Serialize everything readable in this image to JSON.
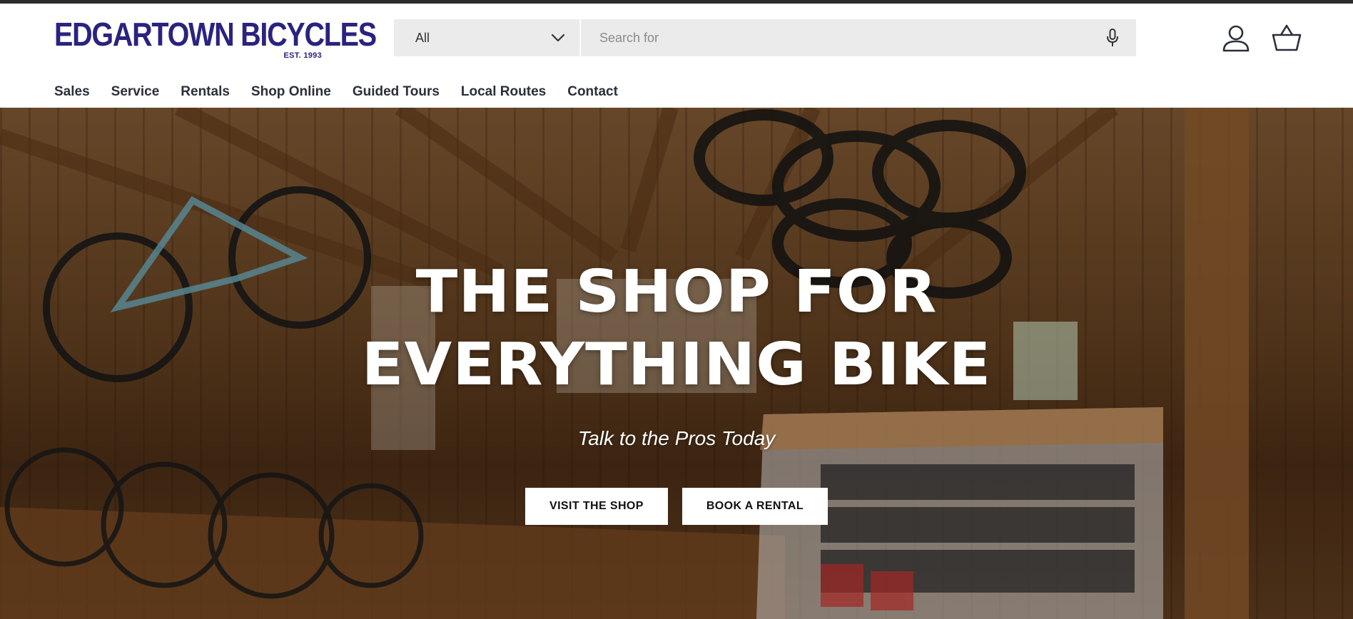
{
  "brand": {
    "name": "EDGARTOWN BICYCLES",
    "established": "EST. 1993",
    "color": "#2a2380"
  },
  "search": {
    "category": "All",
    "placeholder": "Search for"
  },
  "icons": {
    "category_toggle": "chevron-down-icon",
    "voice_search": "microphone-icon",
    "account": "account-icon",
    "cart": "basket-icon"
  },
  "nav": {
    "items": [
      "Sales",
      "Service",
      "Rentals",
      "Shop Online",
      "Guided Tours",
      "Local Routes",
      "Contact"
    ]
  },
  "hero": {
    "title_line1": "THE SHOP FOR",
    "title_line2": "EVERYTHING BIKE",
    "subtitle": "Talk to the Pros Today",
    "primary_button": "VISIT THE SHOP",
    "secondary_button": "BOOK A RENTAL"
  }
}
